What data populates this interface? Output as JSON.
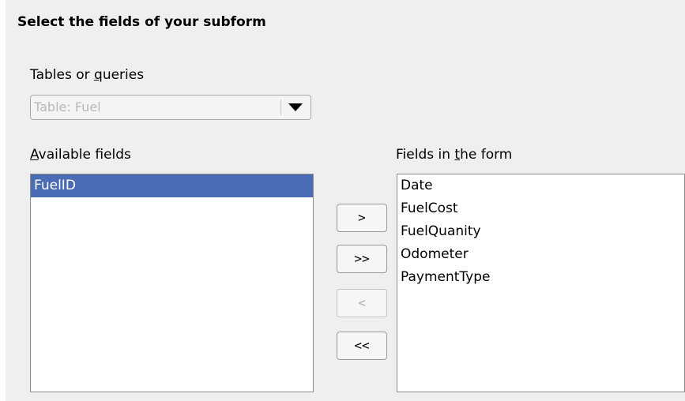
{
  "heading": "Select the fields of your subform",
  "tables_label": {
    "before": "Tables or ",
    "underlined": "q",
    "after": "ueries"
  },
  "table_select": {
    "value": "Table: Fuel",
    "disabled": true
  },
  "available_label": {
    "before": "",
    "underlined": "A",
    "after": "vailable fields"
  },
  "available_fields": [
    {
      "label": "FuelID",
      "selected": true
    }
  ],
  "form_fields_label": {
    "before": "Fields in ",
    "underlined": "t",
    "after": "he form"
  },
  "form_fields": [
    {
      "label": "Date"
    },
    {
      "label": "FuelCost"
    },
    {
      "label": "FuelQuanity"
    },
    {
      "label": "Odometer"
    },
    {
      "label": "PaymentType"
    }
  ],
  "buttons": {
    "add": {
      "label": ">",
      "enabled": true
    },
    "add_all": {
      "label": ">>",
      "enabled": true
    },
    "remove": {
      "label": "<",
      "enabled": false
    },
    "remove_all": {
      "label": "<<",
      "enabled": true
    }
  },
  "colors": {
    "selection": "#4a6cb4",
    "dialog_bg": "#efefef"
  }
}
